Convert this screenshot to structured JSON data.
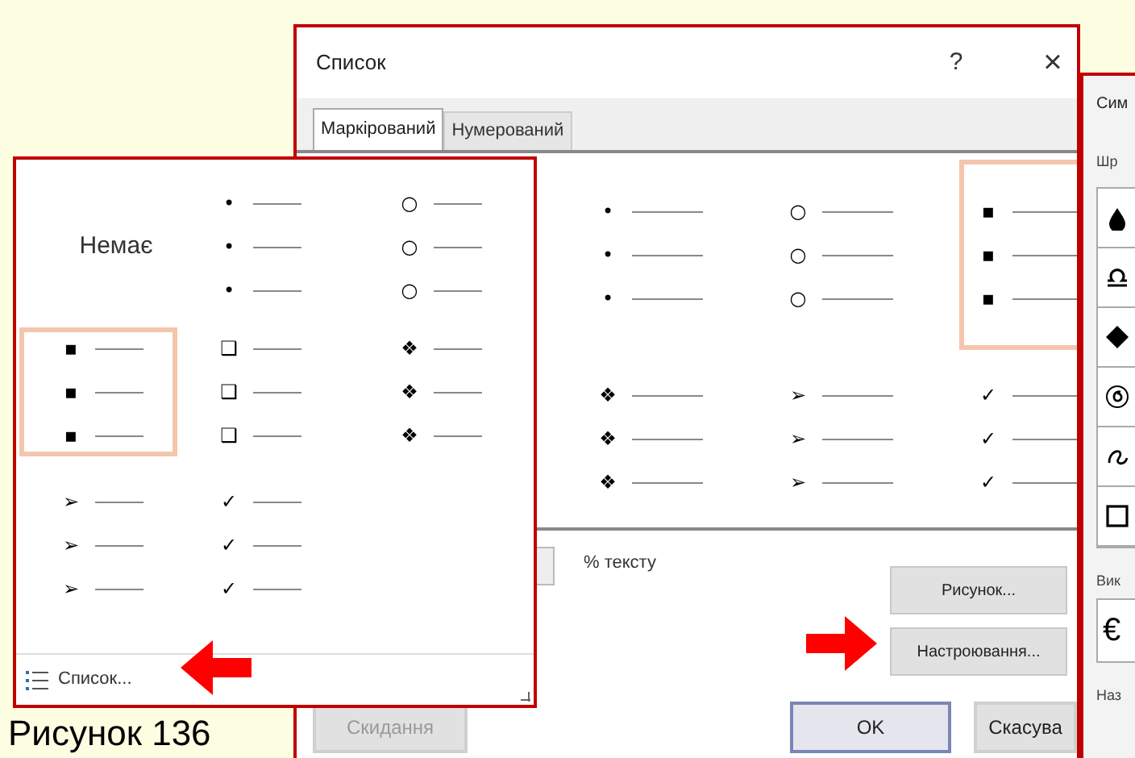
{
  "caption": "Рисунок 136",
  "dialog": {
    "title": "Список",
    "help": "?",
    "close": "×",
    "tabs": [
      {
        "label": "Маркірований",
        "selected": true
      },
      {
        "label": "Нумерований",
        "selected": false
      }
    ],
    "cells": [
      {
        "kind": "bullets",
        "bullets": [
          "•",
          "•",
          "•"
        ],
        "selected": false
      },
      {
        "kind": "bullets",
        "bullets": [
          "○",
          "○",
          "○"
        ],
        "selected": false
      },
      {
        "kind": "bullets",
        "bullets": [
          "▪",
          "▪",
          "▪"
        ],
        "selected": true
      },
      {
        "kind": "bullets",
        "bullets": [
          "❖",
          "❖",
          "❖"
        ],
        "selected": false
      },
      {
        "kind": "bullets",
        "bullets": [
          "➢",
          "➢",
          "➢"
        ],
        "selected": false
      },
      {
        "kind": "bullets",
        "bullets": [
          "✓",
          "✓",
          "✓"
        ],
        "selected": false
      }
    ],
    "size_suffix": "% тексту",
    "buttons": [
      {
        "label": "Рисунок..."
      },
      {
        "label": "Настроювання..."
      }
    ],
    "footer_buttons": [
      {
        "label": "Скидання",
        "disabled": true,
        "default": false
      },
      {
        "label": "OK",
        "disabled": false,
        "default": true
      },
      {
        "label": "Скасува",
        "disabled": false,
        "default": false
      }
    ]
  },
  "popup": {
    "cells": [
      {
        "kind": "none",
        "label": "Немає",
        "selected": false
      },
      {
        "kind": "bullets",
        "bullets": [
          "•",
          "•",
          "•"
        ],
        "selected": false
      },
      {
        "kind": "bullets",
        "bullets": [
          "○",
          "○",
          "○"
        ],
        "selected": false
      },
      {
        "kind": "bullets",
        "bullets": [
          "▪",
          "▪",
          "▪"
        ],
        "selected": true
      },
      {
        "kind": "bullets",
        "bullets": [
          "❑",
          "❑",
          "❑"
        ],
        "selected": false
      },
      {
        "kind": "bullets",
        "bullets": [
          "❖",
          "❖",
          "❖"
        ],
        "selected": false
      },
      {
        "kind": "bullets",
        "bullets": [
          "➢",
          "➢",
          "➢"
        ],
        "selected": false
      },
      {
        "kind": "bullets",
        "bullets": [
          "✓",
          "✓",
          "✓"
        ],
        "selected": false
      }
    ],
    "link": "Список..."
  },
  "symbol_window": {
    "title": "Сим",
    "font_label": "Шр",
    "recent_label": "Вик",
    "recent_symbols": [
      "€"
    ],
    "name_label": "Наз"
  }
}
